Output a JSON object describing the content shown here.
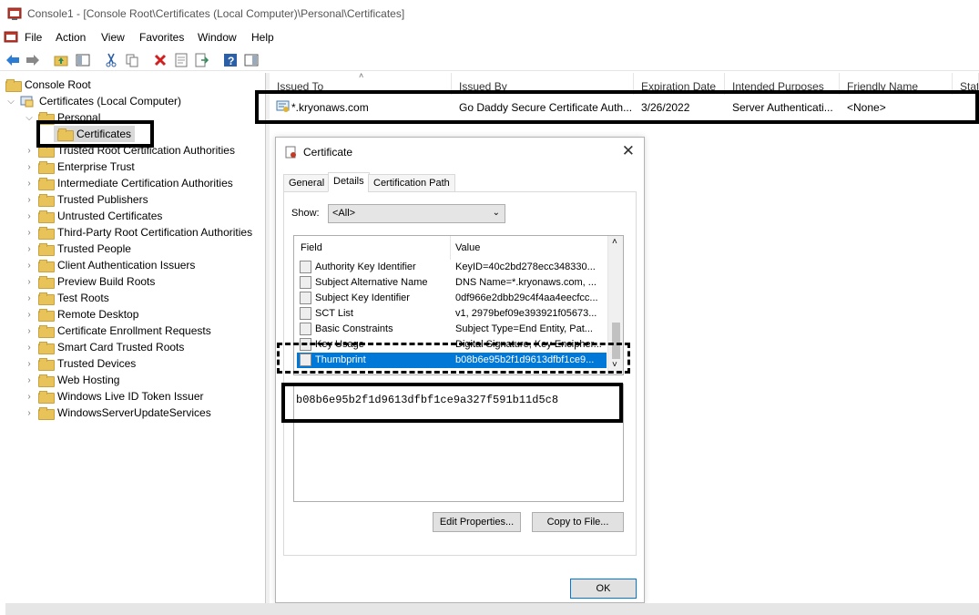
{
  "window": {
    "title": "Console1 - [Console Root\\Certificates (Local Computer)\\Personal\\Certificates]"
  },
  "menu": [
    "File",
    "Action",
    "View",
    "Favorites",
    "Window",
    "Help"
  ],
  "tree": {
    "root": "Console Root",
    "computer": "Certificates (Local Computer)",
    "personal": "Personal",
    "certificates": "Certificates",
    "stores": [
      "Trusted Root Certification Authorities",
      "Enterprise Trust",
      "Intermediate Certification Authorities",
      "Trusted Publishers",
      "Untrusted Certificates",
      "Third-Party Root Certification Authorities",
      "Trusted People",
      "Client Authentication Issuers",
      "Preview Build Roots",
      "Test Roots",
      "Remote Desktop",
      "Certificate Enrollment Requests",
      "Smart Card Trusted Roots",
      "Trusted Devices",
      "Web Hosting",
      "Windows Live ID Token Issuer",
      "WindowsServerUpdateServices"
    ]
  },
  "list": {
    "columns": [
      "Issued To",
      "Issued By",
      "Expiration Date",
      "Intended Purposes",
      "Friendly Name",
      "Stat"
    ],
    "row": {
      "issued_to": "*.kryonaws.com",
      "issued_by": "Go Daddy Secure Certificate Auth...",
      "expiration": "3/26/2022",
      "purposes": "Server Authenticati...",
      "friendly": "<None>"
    }
  },
  "dialog": {
    "title": "Certificate",
    "tabs": [
      "General",
      "Details",
      "Certification Path"
    ],
    "show_label": "Show:",
    "show_value": "<All>",
    "field_header": "Field",
    "value_header": "Value",
    "rows": [
      {
        "field": "Authority Key Identifier",
        "value": "KeyID=40c2bd278ecc348330..."
      },
      {
        "field": "Subject Alternative Name",
        "value": "DNS Name=*.kryonaws.com, ..."
      },
      {
        "field": "Subject Key Identifier",
        "value": "0df966e2dbb29c4f4aa4eecfcc..."
      },
      {
        "field": "SCT List",
        "value": "v1, 2979bef09e393921f05673..."
      },
      {
        "field": "Basic Constraints",
        "value": "Subject Type=End Entity, Pat..."
      },
      {
        "field": "Key Usage",
        "value": "Digital Signature, Key Encipher..."
      },
      {
        "field": "Thumbprint",
        "value": "b08b6e95b2f1d9613dfbf1ce9..."
      }
    ],
    "thumbprint_full": "b08b6e95b2f1d9613dfbf1ce9a327f591b11d5c8",
    "edit_properties": "Edit Properties...",
    "copy_to_file": "Copy to File...",
    "ok": "OK"
  }
}
